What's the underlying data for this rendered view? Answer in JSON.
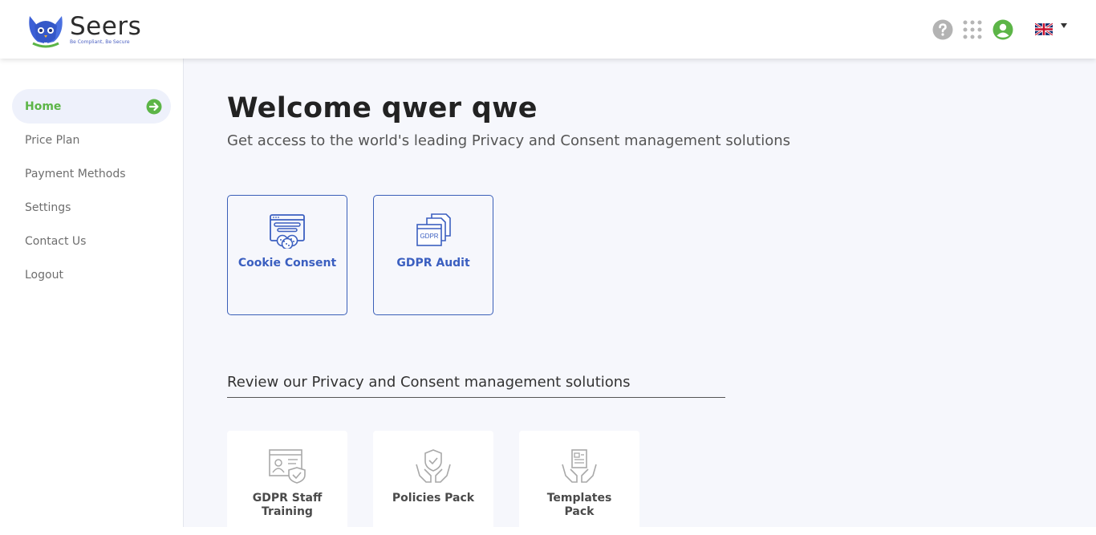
{
  "brand": {
    "name": "Seers",
    "tagline": "Be Compliant, Be Secure"
  },
  "header": {
    "icons": [
      "help-icon",
      "apps-grid-icon",
      "user-account-icon",
      "uk-flag-icon",
      "caret-down-icon"
    ]
  },
  "sidebar": {
    "items": [
      {
        "label": "Home",
        "active": true
      },
      {
        "label": "Price Plan"
      },
      {
        "label": "Payment Methods"
      },
      {
        "label": "Settings"
      },
      {
        "label": "Contact Us"
      },
      {
        "label": "Logout"
      }
    ]
  },
  "main": {
    "welcome": "Welcome qwer qwe",
    "subtitle": "Get access to the world's leading Privacy and Consent management solutions",
    "cards": [
      {
        "label": "Cookie Consent",
        "icon": "cookie-consent-icon"
      },
      {
        "label": "GDPR Audit",
        "icon": "gdpr-audit-icon",
        "icon_text": "GDPR"
      }
    ],
    "review_title": "Review our Privacy and Consent management solutions",
    "tiles": [
      {
        "label": "GDPR Staff Training",
        "icon": "staff-training-icon"
      },
      {
        "label": "Policies Pack",
        "icon": "policies-pack-icon"
      },
      {
        "label": "Templates Pack",
        "icon": "templates-pack-icon"
      }
    ]
  },
  "colors": {
    "accent_green": "#5cb547",
    "accent_blue": "#3b5fc0",
    "main_bg": "#f6f7fc"
  }
}
